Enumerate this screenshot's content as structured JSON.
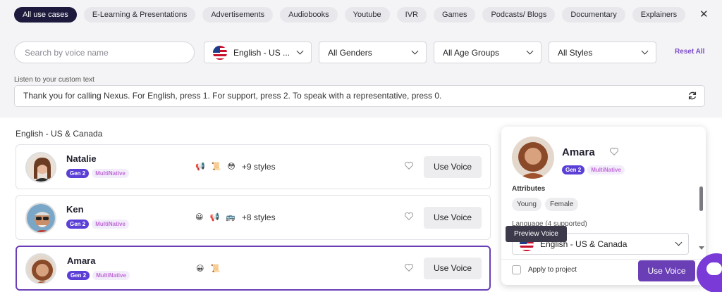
{
  "categories": [
    "All use cases",
    "E-Learning & Presentations",
    "Advertisements",
    "Audiobooks",
    "Youtube",
    "IVR",
    "Games",
    "Podcasts/ Blogs",
    "Documentary",
    "Explainers"
  ],
  "close_label": "✕",
  "filters": {
    "search_placeholder": "Search by voice name",
    "language": "English - US ...",
    "gender": "All Genders",
    "age": "All Age Groups",
    "style": "All Styles",
    "reset": "Reset All"
  },
  "custom_text": {
    "label": "Listen to your custom text",
    "value": "Thank you for calling Nexus. For English, press 1. For support, press 2. To speak with a representative, press 0."
  },
  "section_title": "English - US & Canada",
  "voices": [
    {
      "name": "Natalie",
      "badge_gen": "Gen 2",
      "badge_mn": "MultiNative",
      "style_icons": [
        "📢",
        "📜",
        "😳"
      ],
      "more_styles": "+9 styles",
      "action": "Use Voice"
    },
    {
      "name": "Ken",
      "badge_gen": "Gen 2",
      "badge_mn": "MultiNative",
      "style_icons": [
        "😀",
        "📢",
        "🚌"
      ],
      "more_styles": "+8 styles",
      "action": "Use Voice"
    },
    {
      "name": "Amara",
      "badge_gen": "Gen 2",
      "badge_mn": "MultiNative",
      "style_icons": [
        "😀",
        "📜"
      ],
      "more_styles": "",
      "action": "Use Voice"
    }
  ],
  "detail": {
    "name": "Amara",
    "badge_gen": "Gen 2",
    "badge_mn": "MultiNative",
    "attributes_heading": "Attributes",
    "attributes": [
      "Young",
      "Female"
    ],
    "language_heading": "Language (4 supported)",
    "language_value": "English - US & Canada",
    "tooltip": "Preview Voice",
    "apply_label": "Apply to project",
    "use_button": "Use Voice"
  },
  "colors": {
    "accent": "#6a3fb6",
    "active_chip": "#1e1a3d",
    "gen_badge": "#5b3fd6"
  }
}
